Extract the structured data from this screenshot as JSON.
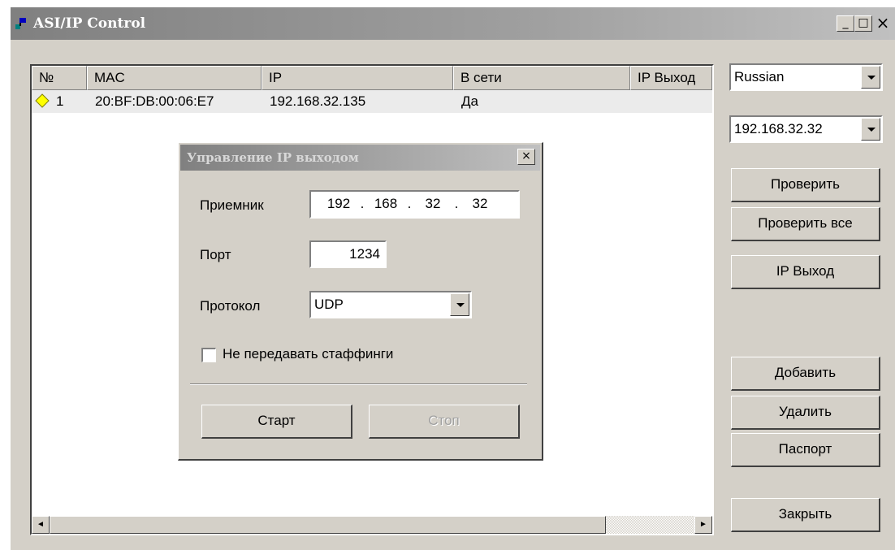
{
  "window": {
    "title": "ASI/IP Control",
    "minimize": "_",
    "maximize": "□",
    "close": "×"
  },
  "list": {
    "columns": [
      "№",
      "MAC",
      "IP",
      "В сети",
      "IP Выход"
    ],
    "rows": [
      {
        "num": "1",
        "mac": "20:BF:DB:00:06:E7",
        "ip": "192.168.32.135",
        "online": "Да",
        "ip_out": "",
        "icon": "yellow-diamond-icon"
      }
    ]
  },
  "scrollbar": {
    "left": "◄",
    "right": "►"
  },
  "side": {
    "language": "Russian",
    "ip_select": "192.168.32.32",
    "check": "Проверить",
    "check_all": "Проверить все",
    "ip_output": "IP Выход",
    "add": "Добавить",
    "delete": "Удалить",
    "passport": "Паспорт",
    "close": "Закрыть"
  },
  "dialog": {
    "title": "Управление IP выходом",
    "close": "×",
    "receiver_label": "Приемник",
    "receiver_ip": [
      "192",
      ".",
      "168",
      ".",
      "32",
      ".",
      "32"
    ],
    "port_label": "Порт",
    "port_value": "1234",
    "protocol_label": "Протокол",
    "protocol_value": "UDP",
    "no_stuffing_label": "Не передавать стаффинги",
    "no_stuffing_checked": false,
    "start": "Старт",
    "stop": "Стоп"
  }
}
